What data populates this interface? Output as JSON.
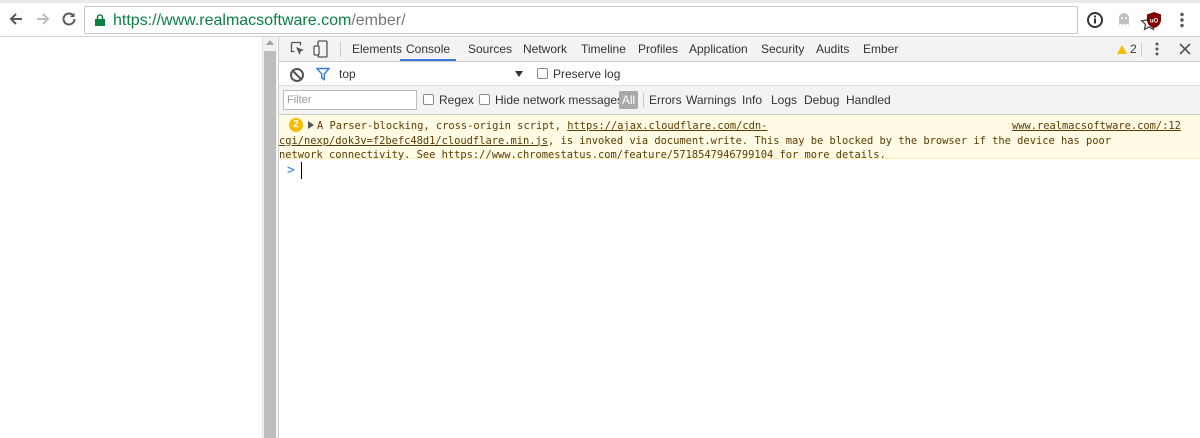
{
  "browser": {
    "url_scheme": "https://",
    "url_host": "www.realmacsoftware.com",
    "url_path": "/ember/",
    "icons": [
      "back-arrow-icon",
      "forward-arrow-icon",
      "reload-icon",
      "lock-icon",
      "star-icon",
      "info-extension-icon",
      "ghost-extension-icon",
      "ublock-extension-icon",
      "menu-kebab-icon"
    ],
    "accent_secure": "#0b8043"
  },
  "devtools": {
    "tabs": [
      "Elements",
      "Console",
      "Sources",
      "Network",
      "Timeline",
      "Profiles",
      "Application",
      "Security",
      "Audits",
      "Ember"
    ],
    "active_tab": "Console",
    "warning_count": "2",
    "accent_tab": "#3879d9"
  },
  "console_toolbar": {
    "context": "top",
    "preserve_log_label": "Preserve log"
  },
  "filter_bar": {
    "filter_placeholder": "Filter",
    "regex_label": "Regex",
    "hide_network_label": "Hide network messages",
    "levels": [
      "All",
      "Errors",
      "Warnings",
      "Info",
      "Logs",
      "Debug",
      "Handled"
    ],
    "selected_level": "All"
  },
  "message": {
    "repeat_count": "2",
    "text_prefix": "A Parser-blocking, cross-origin script, ",
    "link_line1": "https://ajax.cloudflare.com/cdn-",
    "link_line2": "cgi/nexp/dok3v=f2befc48d1/cloudflare.min.js",
    "text_line2_rest": ", is invoked via document.write. This may be blocked by the browser if the device has poor",
    "text_line3": "network connectivity. See https://www.chromestatus.com/feature/5718547946799104 for more details.",
    "source": "www.realmacsoftware.com/:12",
    "background": "#fffbe5"
  },
  "prompt": {
    "symbol": ">"
  }
}
